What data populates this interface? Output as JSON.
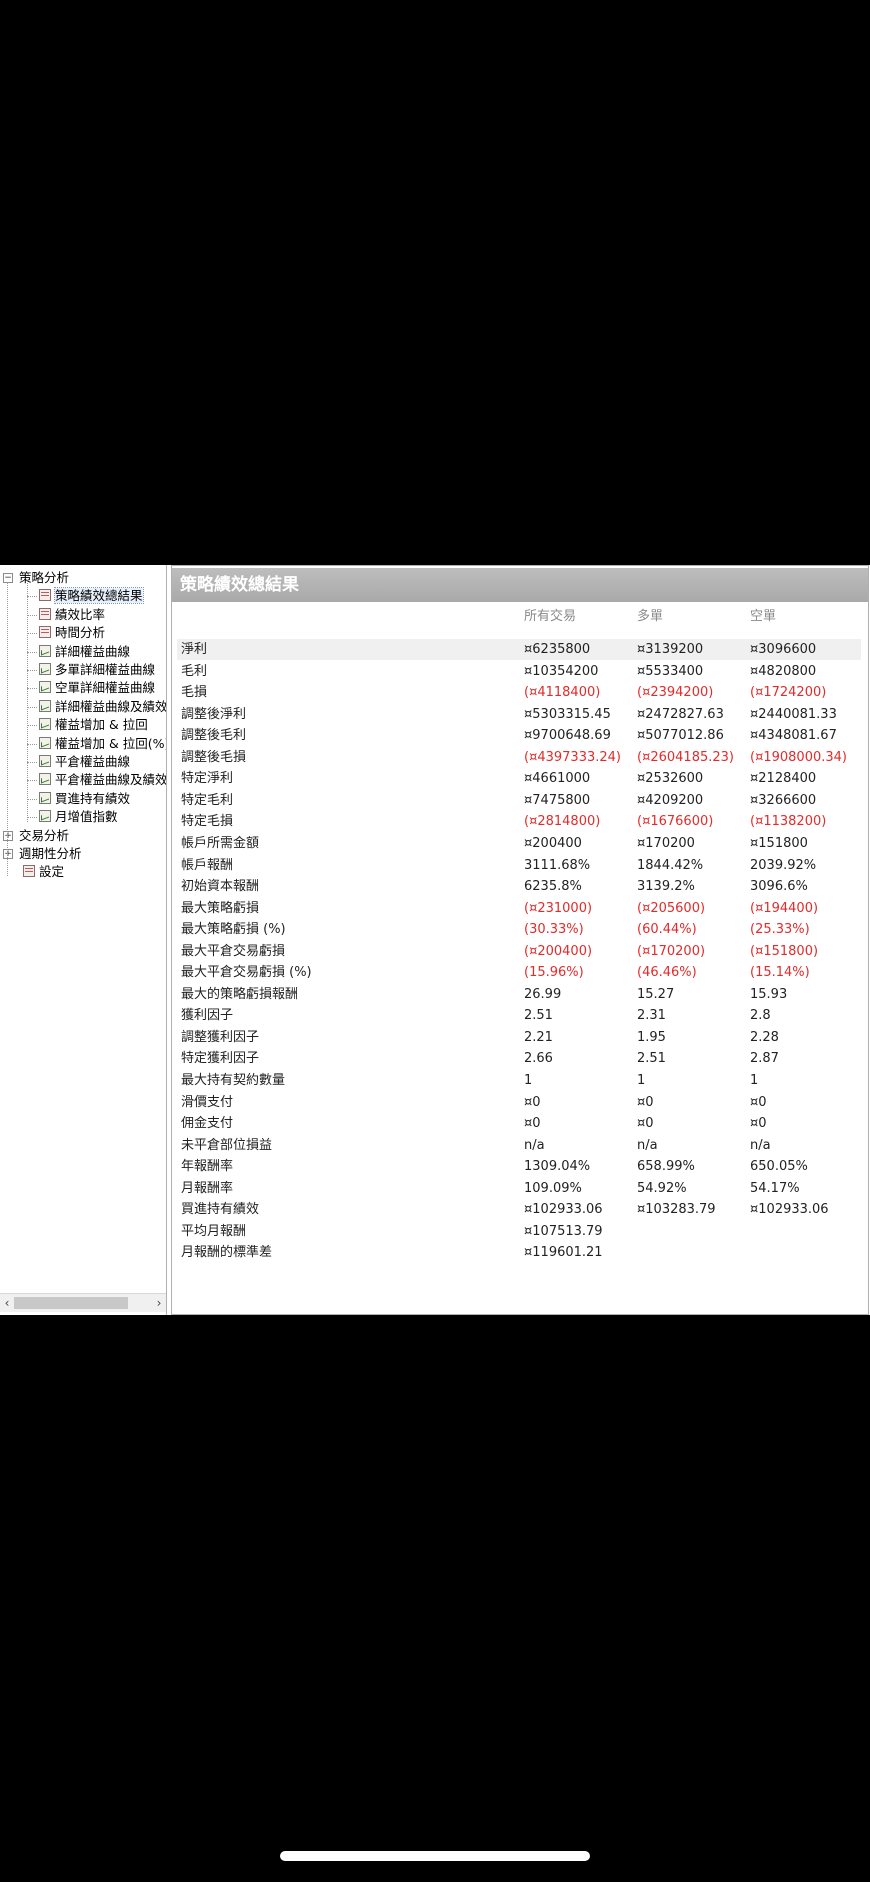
{
  "sidebar": {
    "items": [
      {
        "label": "策略分析",
        "level": 0,
        "expander": "minus",
        "icon": "none"
      },
      {
        "label": "策略績效總結果",
        "level": 1,
        "icon": "doc-icon",
        "selected": true
      },
      {
        "label": "績效比率",
        "level": 1,
        "icon": "doc-icon"
      },
      {
        "label": "時間分析",
        "level": 1,
        "icon": "doc-icon"
      },
      {
        "label": "詳細權益曲線",
        "level": 1,
        "icon": "chart-icon"
      },
      {
        "label": "多單詳細權益曲線",
        "level": 1,
        "icon": "chart-icon"
      },
      {
        "label": "空單詳細權益曲線",
        "level": 1,
        "icon": "chart-icon"
      },
      {
        "label": "詳細權益曲線及績效",
        "level": 1,
        "icon": "chart-icon"
      },
      {
        "label": "權益增加 & 拉回",
        "level": 1,
        "icon": "chart-icon"
      },
      {
        "label": "權益增加 & 拉回(%)",
        "level": 1,
        "icon": "chart-icon"
      },
      {
        "label": "平倉權益曲線",
        "level": 1,
        "icon": "chart-icon"
      },
      {
        "label": "平倉權益曲線及績效",
        "level": 1,
        "icon": "chart-icon"
      },
      {
        "label": "買進持有績效",
        "level": 1,
        "icon": "chart-icon"
      },
      {
        "label": "月增值指數",
        "level": 1,
        "icon": "chart-icon"
      },
      {
        "label": "交易分析",
        "level": 0,
        "expander": "plus",
        "icon": "none"
      },
      {
        "label": "週期性分析",
        "level": 0,
        "expander": "plus",
        "icon": "none"
      },
      {
        "label": "設定",
        "level": 0,
        "icon": "doc-icon"
      }
    ],
    "scroll_left": "‹",
    "scroll_right": "›"
  },
  "main": {
    "title": "策略績效總結果",
    "columns": [
      "所有交易",
      "多單",
      "空單"
    ],
    "rows": [
      {
        "label": "淨利",
        "values": [
          "¤6235800",
          "¤3139200",
          "¤3096600"
        ]
      },
      {
        "label": "毛利",
        "values": [
          "¤10354200",
          "¤5533400",
          "¤4820800"
        ]
      },
      {
        "label": "毛損",
        "values": [
          "(¤4118400)",
          "(¤2394200)",
          "(¤1724200)"
        ]
      },
      {
        "label": "調整後淨利",
        "values": [
          "¤5303315.45",
          "¤2472827.63",
          "¤2440081.33"
        ]
      },
      {
        "label": "調整後毛利",
        "values": [
          "¤9700648.69",
          "¤5077012.86",
          "¤4348081.67"
        ]
      },
      {
        "label": "調整後毛損",
        "values": [
          "(¤4397333.24)",
          "(¤2604185.23)",
          "(¤1908000.34)"
        ]
      },
      {
        "label": "特定淨利",
        "values": [
          "¤4661000",
          "¤2532600",
          "¤2128400"
        ]
      },
      {
        "label": "特定毛利",
        "values": [
          "¤7475800",
          "¤4209200",
          "¤3266600"
        ]
      },
      {
        "label": "特定毛損",
        "values": [
          "(¤2814800)",
          "(¤1676600)",
          "(¤1138200)"
        ]
      },
      {
        "label": "帳戶所需金額",
        "values": [
          "¤200400",
          "¤170200",
          "¤151800"
        ]
      },
      {
        "label": "帳戶報酬",
        "values": [
          "3111.68%",
          "1844.42%",
          "2039.92%"
        ]
      },
      {
        "label": "初始資本報酬",
        "values": [
          "6235.8%",
          "3139.2%",
          "3096.6%"
        ]
      },
      {
        "label": "最大策略虧損",
        "values": [
          "(¤231000)",
          "(¤205600)",
          "(¤194400)"
        ]
      },
      {
        "label": "最大策略虧損 (%)",
        "values": [
          "(30.33%)",
          "(60.44%)",
          "(25.33%)"
        ]
      },
      {
        "label": "最大平倉交易虧損",
        "values": [
          "(¤200400)",
          "(¤170200)",
          "(¤151800)"
        ]
      },
      {
        "label": "最大平倉交易虧損 (%)",
        "values": [
          "(15.96%)",
          "(46.46%)",
          "(15.14%)"
        ]
      },
      {
        "label": "最大的策略虧損報酬",
        "values": [
          "26.99",
          "15.27",
          "15.93"
        ]
      },
      {
        "label": "獲利因子",
        "values": [
          "2.51",
          "2.31",
          "2.8"
        ]
      },
      {
        "label": "調整獲利因子",
        "values": [
          "2.21",
          "1.95",
          "2.28"
        ]
      },
      {
        "label": "特定獲利因子",
        "values": [
          "2.66",
          "2.51",
          "2.87"
        ]
      },
      {
        "label": "最大持有契約數量",
        "values": [
          "1",
          "1",
          "1"
        ]
      },
      {
        "label": "滑價支付",
        "values": [
          "¤0",
          "¤0",
          "¤0"
        ]
      },
      {
        "label": "佣金支付",
        "values": [
          "¤0",
          "¤0",
          "¤0"
        ]
      },
      {
        "label": "未平倉部位損益",
        "values": [
          "n/a",
          "n/a",
          "n/a"
        ]
      },
      {
        "label": "年報酬率",
        "values": [
          "1309.04%",
          "658.99%",
          "650.05%"
        ]
      },
      {
        "label": "月報酬率",
        "values": [
          "109.09%",
          "54.92%",
          "54.17%"
        ]
      },
      {
        "label": "買進持有績效",
        "values": [
          "¤102933.06",
          "¤103283.79",
          "¤102933.06"
        ]
      },
      {
        "label": "平均月報酬",
        "values": [
          "¤107513.79",
          "",
          ""
        ]
      },
      {
        "label": "月報酬的標準差",
        "values": [
          "¤119601.21",
          "",
          ""
        ]
      }
    ]
  },
  "colors": {
    "negative": "#e22b2b",
    "header_bg": "#b3b3b3",
    "row_shade": "#f0f0f0"
  }
}
